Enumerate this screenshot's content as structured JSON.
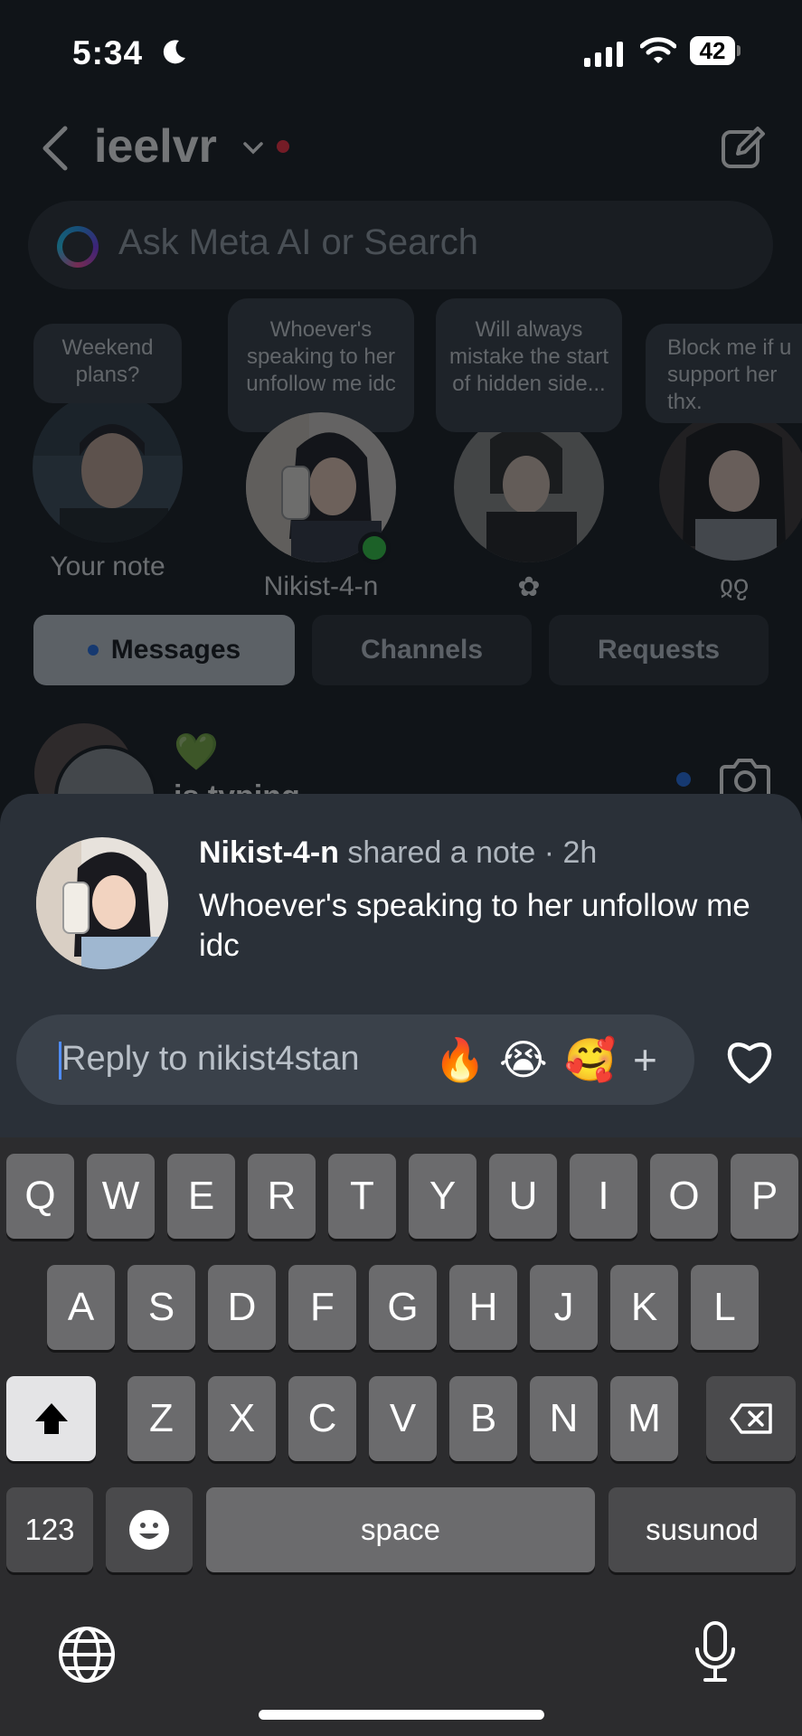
{
  "status": {
    "time": "5:34",
    "battery": "42"
  },
  "header": {
    "username": "ieelvr"
  },
  "search": {
    "placeholder": "Ask Meta AI or Search"
  },
  "notes": [
    {
      "text": "Weekend plans?",
      "label": "Your note"
    },
    {
      "text": "Whoever's speaking to her unfollow me idc",
      "label": "Nikist-4-n"
    },
    {
      "text": "Will always mistake the start of hidden side...",
      "label": "✿"
    },
    {
      "text": "Block me if u support her thx.",
      "label": "ჲჹ"
    }
  ],
  "tabs": [
    {
      "label": "Messages",
      "active": true
    },
    {
      "label": "Channels",
      "active": false
    },
    {
      "label": "Requests",
      "active": false
    }
  ],
  "thread_preview": {
    "emoji": "💚",
    "status_text": "is typing..."
  },
  "sheet": {
    "author": "Nikist-4-n",
    "meta": " shared a note · 2h",
    "note_text": "Whoever's speaking to her unfollow me idc",
    "reply_placeholder": "Reply to nikist4stan",
    "quick_reactions": [
      "🔥",
      "😭",
      "🥰"
    ],
    "add_label": "+"
  },
  "keyboard": {
    "row1": [
      "Q",
      "W",
      "E",
      "R",
      "T",
      "Y",
      "U",
      "I",
      "O",
      "P"
    ],
    "row2": [
      "A",
      "S",
      "D",
      "F",
      "G",
      "H",
      "J",
      "K",
      "L"
    ],
    "row3": [
      "Z",
      "X",
      "C",
      "V",
      "B",
      "N",
      "M"
    ],
    "numbers_label": "123",
    "space_label": "space",
    "return_label": "susunod"
  },
  "colors": {
    "accent": "#4f8cff",
    "sheet_bg": "#2a3038",
    "online": "#2ecc40",
    "unread": "#ff2a3d"
  }
}
